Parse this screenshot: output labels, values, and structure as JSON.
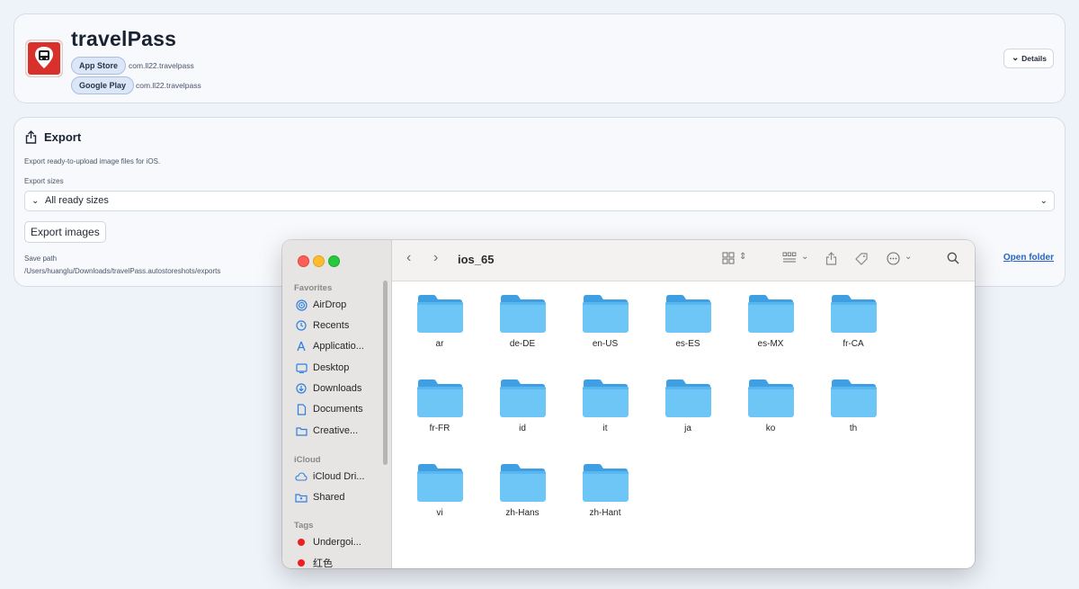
{
  "app": {
    "title": "travelPass",
    "stores": [
      {
        "label": "App Store",
        "package": "com.ll22.travelpass"
      },
      {
        "label": "Google Play",
        "package": "com.ll22.travelpass"
      }
    ],
    "details_label": "Details"
  },
  "export": {
    "title": "Export",
    "description": "Export ready-to-upload image files for iOS.",
    "sizes_label": "Export sizes",
    "sizes_value": "All ready sizes",
    "export_button": "Export images",
    "save_path_label": "Save path",
    "save_path": "/Users/huanglu/Downloads/travelPass.autostoreshots/exports",
    "open_folder": "Open folder"
  },
  "finder": {
    "folder_title": "ios_65",
    "sidebar": {
      "favorites_label": "Favorites",
      "favorites": [
        {
          "label": "AirDrop",
          "icon": "airdrop-icon"
        },
        {
          "label": "Recents",
          "icon": "clock-icon"
        },
        {
          "label": "Applicatio...",
          "icon": "applications-icon"
        },
        {
          "label": "Desktop",
          "icon": "desktop-icon"
        },
        {
          "label": "Downloads",
          "icon": "download-icon"
        },
        {
          "label": "Documents",
          "icon": "document-icon"
        },
        {
          "label": "Creative...",
          "icon": "folder-icon"
        }
      ],
      "icloud_label": "iCloud",
      "icloud": [
        {
          "label": "iCloud Dri...",
          "icon": "cloud-icon"
        },
        {
          "label": "Shared",
          "icon": "shared-folder-icon"
        }
      ],
      "tags_label": "Tags",
      "tags": [
        {
          "label": "Undergoi...",
          "color": "#f01e1e"
        },
        {
          "label": "红色",
          "color": "#f01e1e"
        }
      ]
    },
    "folders": [
      "ar",
      "de-DE",
      "en-US",
      "es-ES",
      "es-MX",
      "fr-CA",
      "fr-FR",
      "id",
      "it",
      "ja",
      "ko",
      "th",
      "vi",
      "zh-Hans",
      "zh-Hant"
    ]
  }
}
